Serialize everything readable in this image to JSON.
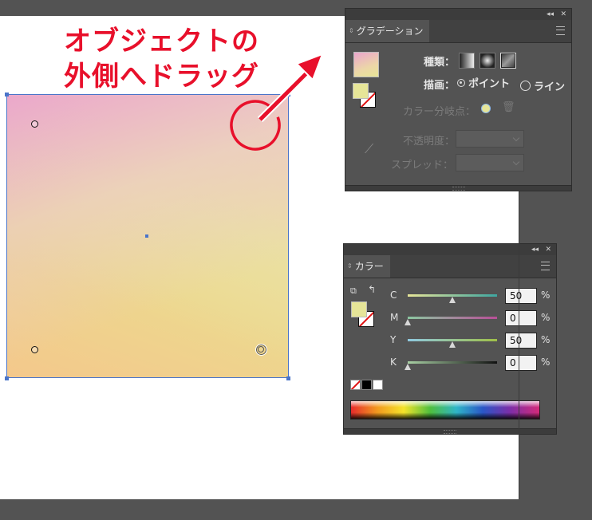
{
  "annotation": {
    "line1": "オブジェクトの",
    "line2": "外側へドラッグ",
    "color": "#e8102b"
  },
  "gradient_panel": {
    "tab_label": "グラデーション",
    "type_label": "種類：",
    "draw_label": "描画：",
    "point_label": "ポイント",
    "line_label": "ライン",
    "stops_label": "カラー分岐点：",
    "opacity_label": "不透明度：",
    "spread_label": "スプレッド：",
    "type_buttons": [
      "linear-gradient-icon",
      "radial-gradient-icon",
      "freeform-gradient-icon"
    ],
    "selected_type": "freeform",
    "selected_draw": "point"
  },
  "color_panel": {
    "tab_label": "カラー",
    "channels": [
      {
        "label": "C",
        "value": "50",
        "unit": "%",
        "level": 0.5
      },
      {
        "label": "M",
        "value": "0",
        "unit": "%",
        "level": 0.0
      },
      {
        "label": "Y",
        "value": "50",
        "unit": "%",
        "level": 0.5
      },
      {
        "label": "K",
        "value": "0",
        "unit": "%",
        "level": 0.0
      }
    ],
    "fill_color": "#e6e598"
  },
  "gradient_colors": {
    "pink": "#eba5cd",
    "yellow": "#e7e596",
    "orange": "#f4c88c"
  }
}
